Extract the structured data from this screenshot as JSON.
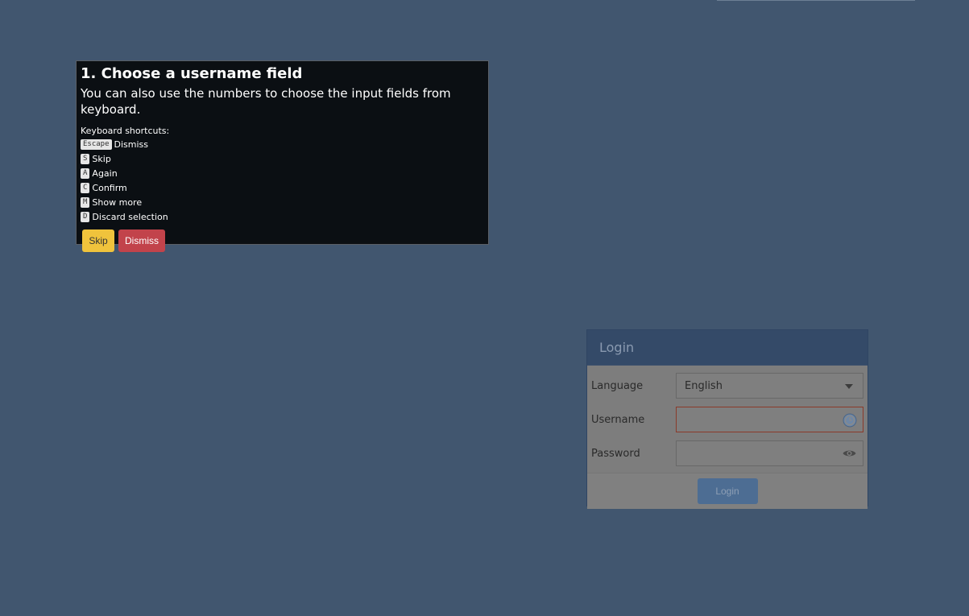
{
  "helper": {
    "title": "1. Choose a username field",
    "description": "You can also use the numbers to choose the input fields from keyboard.",
    "shortcuts_title": "Keyboard shortcuts:",
    "shortcuts": [
      {
        "key": "Escape",
        "label": "Dismiss"
      },
      {
        "key": "S",
        "label": "Skip"
      },
      {
        "key": "A",
        "label": "Again"
      },
      {
        "key": "C",
        "label": "Confirm"
      },
      {
        "key": "M",
        "label": "Show more"
      },
      {
        "key": "D",
        "label": "Discard selection"
      }
    ],
    "skip_label": "Skip",
    "dismiss_label": "Dismiss"
  },
  "login": {
    "title": "Login",
    "language_label": "Language",
    "language_value": "English",
    "username_label": "Username",
    "username_value": "",
    "password_label": "Password",
    "password_value": "",
    "submit_label": "Login"
  },
  "colors": {
    "background": "#41566f",
    "helper_bg": "#0b0f13",
    "skip_button": "#f0c33c",
    "dismiss_button": "#c2434b",
    "login_header": "#344a68",
    "login_button": "#4d6d93",
    "invalid_border": "#8a3a2a"
  },
  "icons": {
    "language_dropdown": "chevron-down-icon",
    "username_field": "clock-icon",
    "password_field": "eye-icon"
  }
}
